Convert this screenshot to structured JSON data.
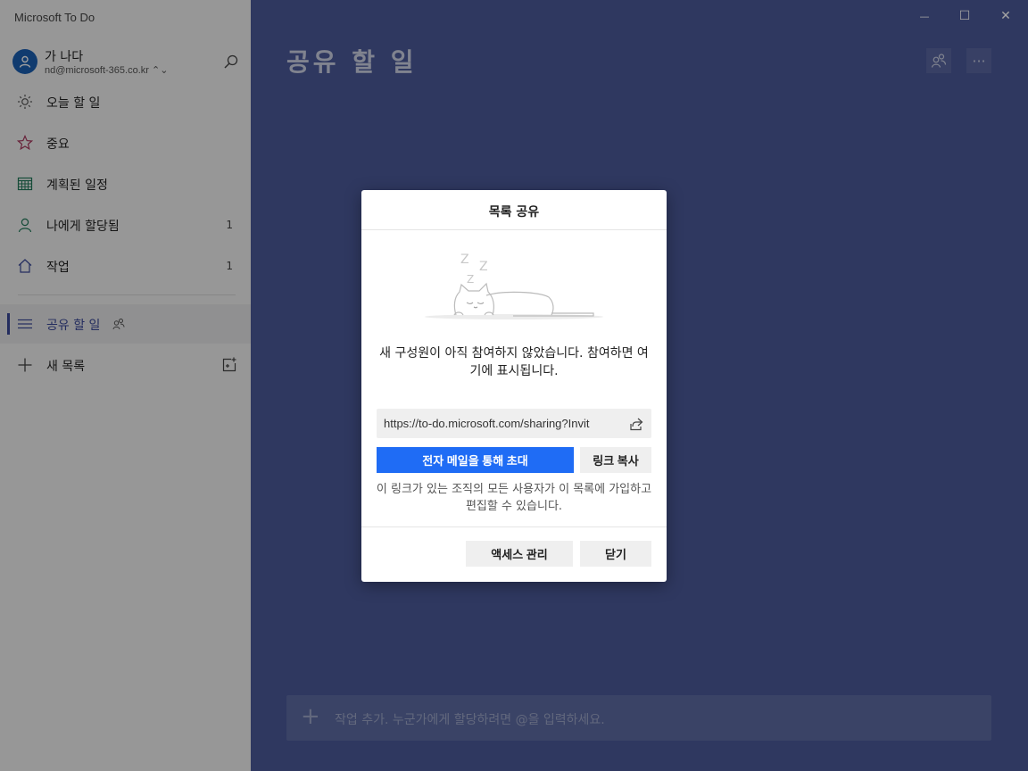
{
  "app": {
    "title": "Microsoft To Do"
  },
  "profile": {
    "name": "가 나다",
    "email": "nd@microsoft-365.co.kr ⌃⌄"
  },
  "sidebar": {
    "items": [
      {
        "label": "오늘 할 일",
        "count": ""
      },
      {
        "label": "중요",
        "count": ""
      },
      {
        "label": "계획된 일정",
        "count": ""
      },
      {
        "label": "나에게 할당됨",
        "count": "1"
      },
      {
        "label": "작업",
        "count": "1"
      }
    ],
    "lists": [
      {
        "label": "공유 할 일"
      }
    ],
    "new_list_label": "새 목록"
  },
  "main": {
    "title": "공유 할 일",
    "more_label": "···",
    "add_task_placeholder": "작업 추가. 누군가에게 할당하려면 @을 입력하세요."
  },
  "window": {
    "minimize": "—",
    "maximize": "☐",
    "close": "✕"
  },
  "dialog": {
    "title": "목록 공유",
    "illustration_letters": [
      "Z",
      "Z",
      "Z"
    ],
    "message": "새 구성원이 아직 참여하지 않았습니다. 참여하면 여기에 표시됩니다.",
    "link_url": "https://to-do.microsoft.com/sharing?Invit",
    "invite_button": "전자 메일을 통해 초대",
    "copy_link_button": "링크 복사",
    "note": "이 링크가 있는 조직의 모든 사용자가 이 목록에 가입하고 편집할 수 있습니다.",
    "manage_access_button": "액세스 관리",
    "close_button": "닫기"
  },
  "colors": {
    "accent": "#1f6cf5",
    "main_bg": "#4a5896",
    "active": "#3b4a9a"
  }
}
